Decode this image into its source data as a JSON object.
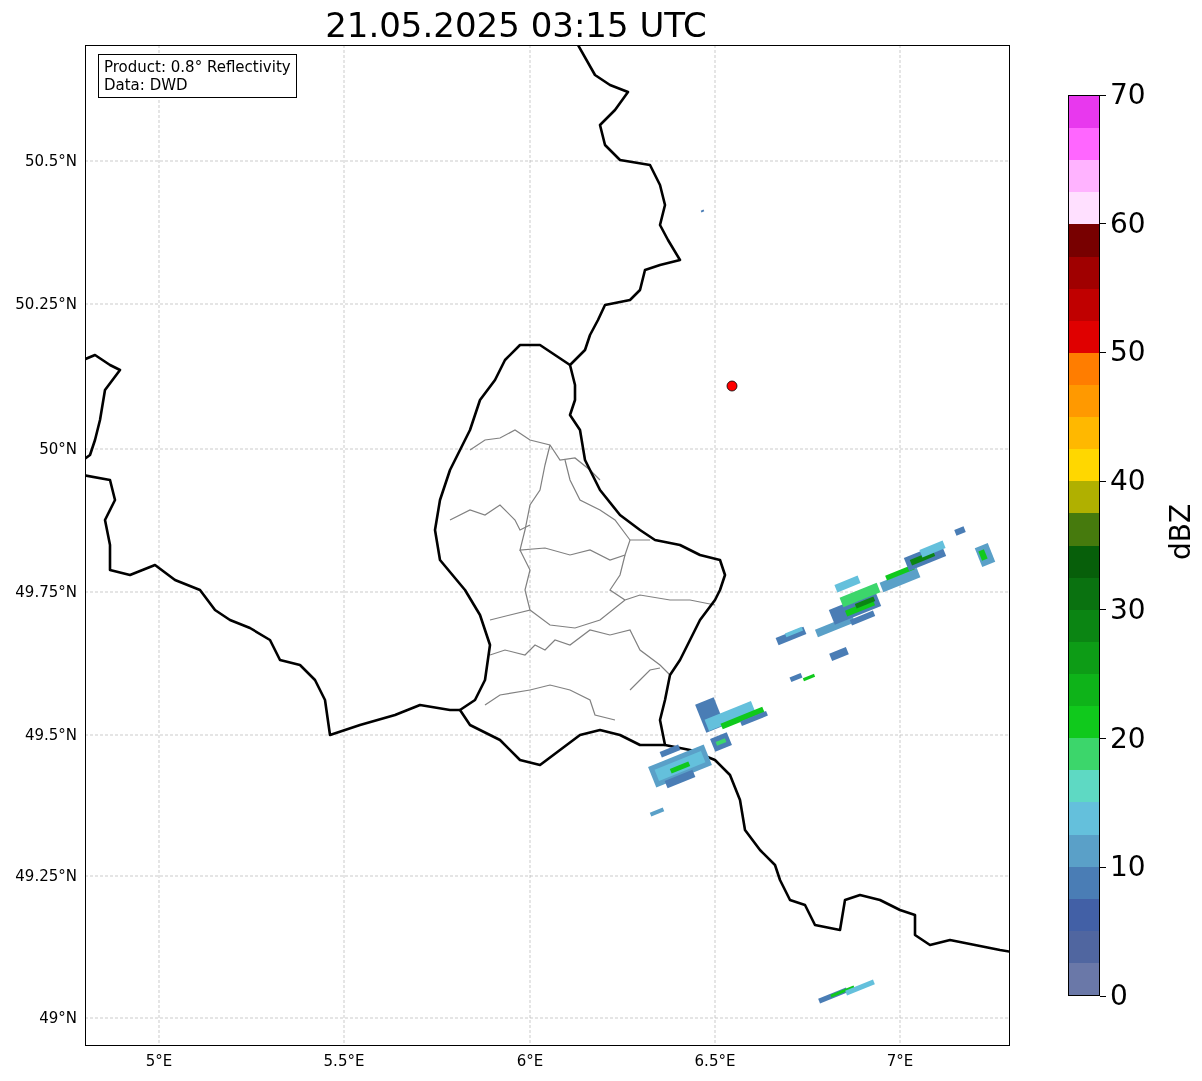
{
  "title": "21.05.2025 03:15 UTC",
  "info_box": [
    "Product: 0.8° Reflectivity",
    "Data: DWD"
  ],
  "map": {
    "y_ticks": [
      "50.5°N",
      "50.25°N",
      "50°N",
      "49.75°N",
      "49.5°N",
      "49.25°N",
      "49°N"
    ],
    "x_ticks": [
      "5°E",
      "5.5°E",
      "6°E",
      "6.5°E",
      "7°E"
    ]
  },
  "colorbar": {
    "label": "dBZ",
    "ticks": [
      "70",
      "60",
      "50",
      "40",
      "30",
      "20",
      "10",
      "0"
    ],
    "bands": [
      {
        "color": "#e838ee"
      },
      {
        "color": "#ff66ff"
      },
      {
        "color": "#ffb3ff"
      },
      {
        "color": "#ffe0ff"
      },
      {
        "color": "#780000"
      },
      {
        "color": "#a00000"
      },
      {
        "color": "#c00000"
      },
      {
        "color": "#e00000"
      },
      {
        "color": "#ff7d00"
      },
      {
        "color": "#ff9900"
      },
      {
        "color": "#ffb800"
      },
      {
        "color": "#ffd700"
      },
      {
        "color": "#b0b000"
      },
      {
        "color": "#467a0d"
      },
      {
        "color": "#075f0a"
      },
      {
        "color": "#0a7210"
      },
      {
        "color": "#0b8513"
      },
      {
        "color": "#0d9c16"
      },
      {
        "color": "#0eb319"
      },
      {
        "color": "#10c91c"
      },
      {
        "color": "#3cd66b"
      },
      {
        "color": "#5ed9c3"
      },
      {
        "color": "#64c0dc"
      },
      {
        "color": "#5aa0c8"
      },
      {
        "color": "#4a7db5"
      },
      {
        "color": "#4260a6"
      },
      {
        "color": "#5066a0"
      },
      {
        "color": "#6a78a8"
      }
    ]
  }
}
